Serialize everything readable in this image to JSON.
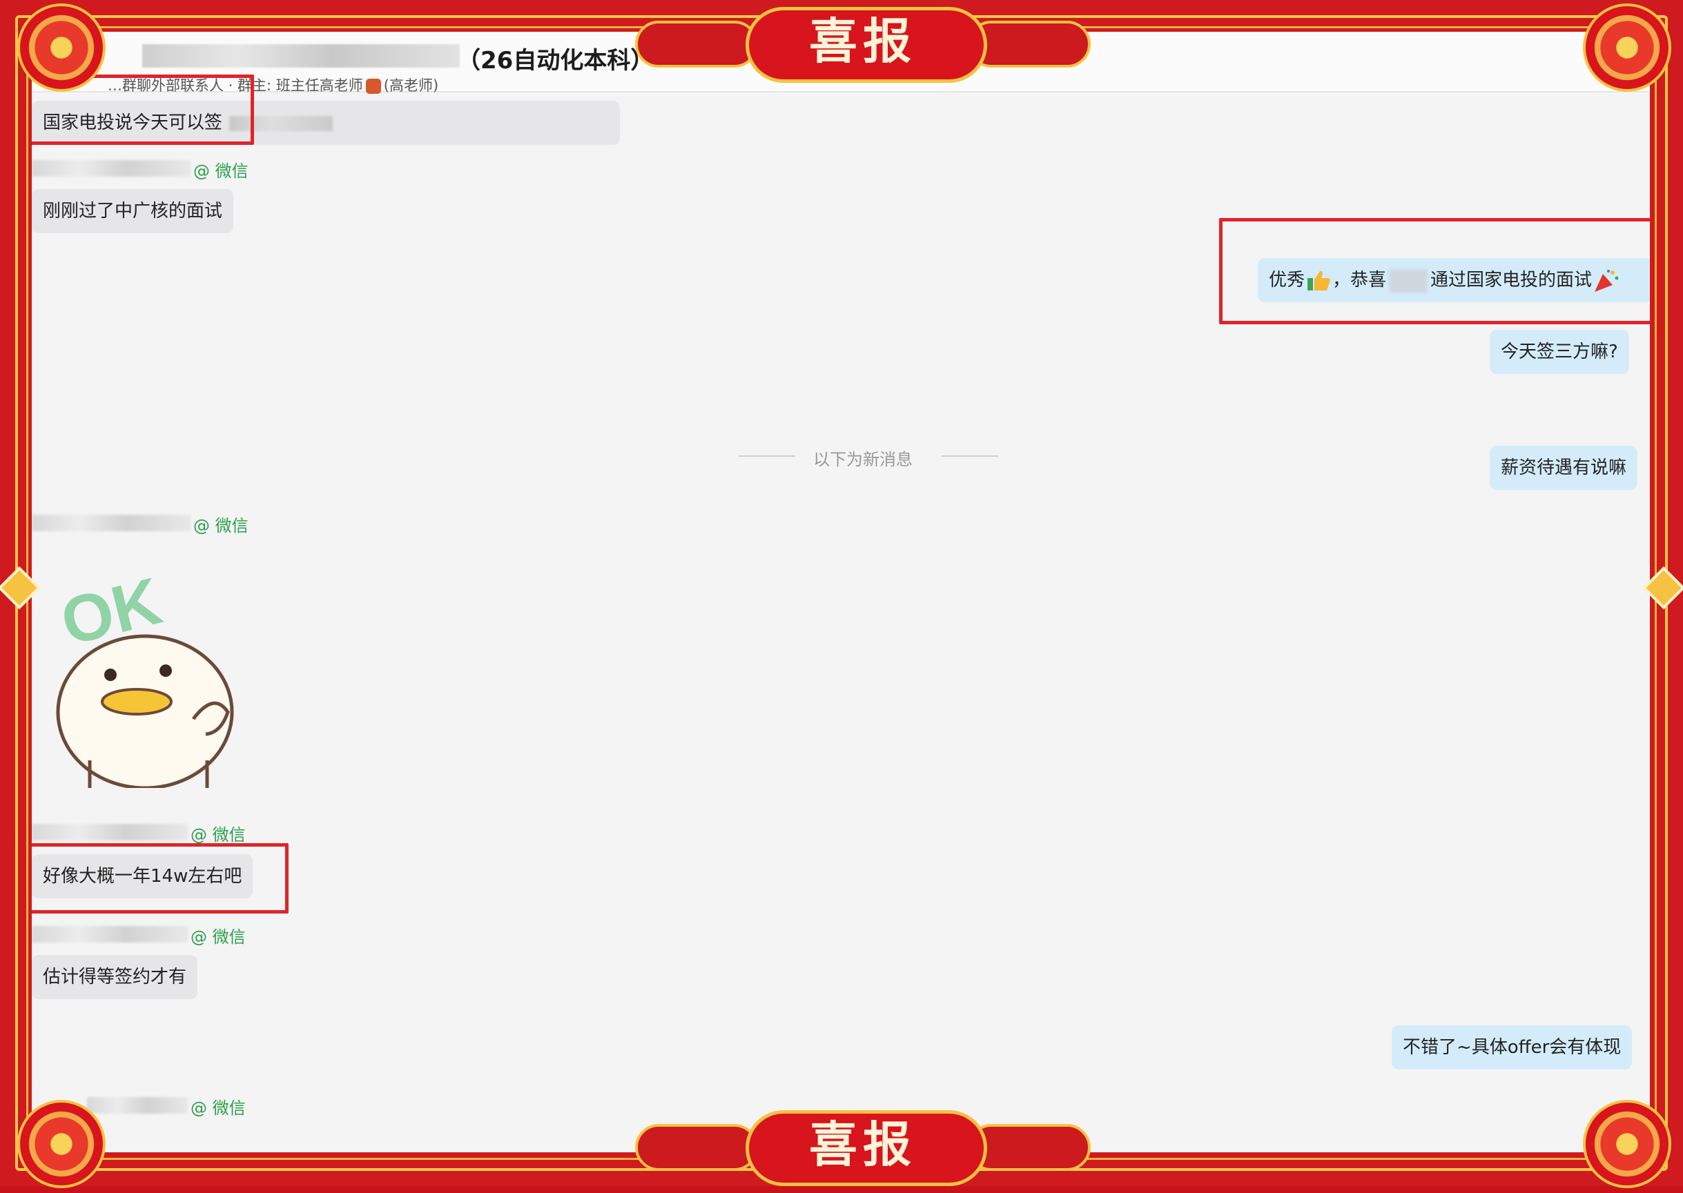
{
  "banner": {
    "text": "喜报"
  },
  "header": {
    "title": "（26自动化本科）",
    "subtitle": "…群聊外部联系人 · 群主: 班主任高老师",
    "subtitle_suffix": "(高老师)"
  },
  "divider": {
    "text": "以下为新消息"
  },
  "messages": [
    {
      "side": "left",
      "text": "国家电投说今天可以签"
    },
    {
      "side": "left",
      "sender_tag": "@ 微信",
      "text": "刚刚过了中广核的面试"
    },
    {
      "side": "right",
      "text_before": "优秀",
      "text_mid": "，恭喜",
      "text_after": "通过国家电投的面试"
    },
    {
      "side": "right",
      "text": "今天签三方嘛?"
    },
    {
      "side": "right",
      "text": "薪资待遇有说嘛"
    },
    {
      "side": "left",
      "sender_tag": "@ 微信",
      "sticker_text": "OK"
    },
    {
      "side": "left",
      "sender_tag": "@ 微信",
      "text": "好像大概一年14w左右吧"
    },
    {
      "side": "left",
      "sender_tag": "@ 微信",
      "text": "估计得等签约才有"
    },
    {
      "side": "right",
      "text": "不错了~具体offer会有体现"
    },
    {
      "side": "left",
      "sender_tag": "@ 微信"
    }
  ],
  "colors": {
    "frame_red": "#cf1b1f",
    "gold": "#f5c242",
    "left_bubble": "#e6e6e8",
    "right_bubble": "#d4ecfa",
    "wechat_green": "#2aa04a",
    "highlight_red": "#e0242a"
  }
}
